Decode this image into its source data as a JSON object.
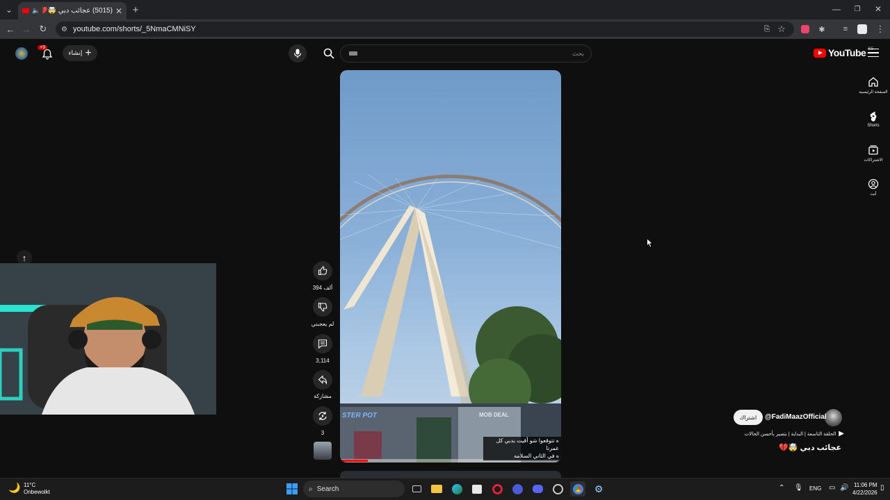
{
  "browser": {
    "tab_title": "(5015) عجائب دبي 🤯💔 - ...",
    "url": "youtube.com/shorts/_5NmaCMNiSY"
  },
  "youtube": {
    "logo_text": "YouTube",
    "region": "BE",
    "search_placeholder": "بحث",
    "create_label": "إنشاء",
    "notification_count": "+9",
    "nav": [
      {
        "label": "الصفحة الرئيسية",
        "icon": "home-icon"
      },
      {
        "label": "Shorts",
        "icon": "shorts-icon"
      },
      {
        "label": "الاشتراكات",
        "icon": "subscriptions-icon"
      },
      {
        "label": "أنت",
        "icon": "you-icon"
      }
    ]
  },
  "short": {
    "likes": "394 ألف",
    "dislike_label": "لم يعجبني",
    "comments": "3,114",
    "share_label": "مشاركة",
    "remix_count": "3",
    "channel": "@FadiMaazOfficial",
    "subscribe_label": "اشتراك",
    "playlist_text": "الحلقة التاسعة | البداية | بتصير بأحسن الحالات",
    "title": "عجائب دبي 🤯💔",
    "caption_line1": "ه تتوقعوا شو أقيت بدبي كل عمرنا",
    "caption_line2": "ه في الثاني السلامه",
    "sign_left": "STER POT",
    "sign_right": "MOB DEAL"
  },
  "taskbar": {
    "weather_temp": "11°C",
    "weather_desc": "Onbewolkt",
    "search_label": "Search",
    "lang": "ENG",
    "time": "11:06 PM",
    "date": "4/22/2026"
  },
  "colors": {
    "yt_red": "#ff0000",
    "bg": "#0f0f0f",
    "chip": "#272727"
  }
}
